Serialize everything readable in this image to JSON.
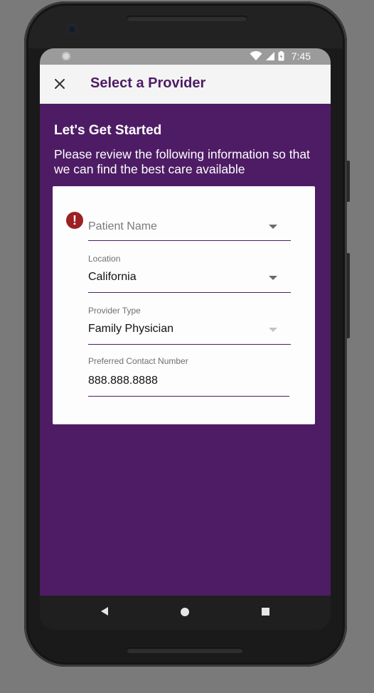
{
  "status_bar": {
    "time": "7:45"
  },
  "app_bar": {
    "close_icon": "close-icon",
    "title": "Select a Provider"
  },
  "intro": {
    "heading": "Let's Get Started",
    "text": "Please review the following information so that we can find the best care available"
  },
  "form": {
    "patient_name": {
      "placeholder": "Patient Name",
      "error_icon": "error-icon"
    },
    "location": {
      "label": "Location",
      "value": "California"
    },
    "provider_type": {
      "label": "Provider Type",
      "value": "Family Physician"
    },
    "contact_number": {
      "label": "Preferred Contact Number",
      "value": "888.888.8888"
    }
  },
  "nav_bar": {
    "back_icon": "back-icon",
    "home_icon": "home-icon",
    "recents_icon": "recents-icon"
  },
  "colors": {
    "brand": "#4e1c65",
    "error": "#9c2024"
  }
}
